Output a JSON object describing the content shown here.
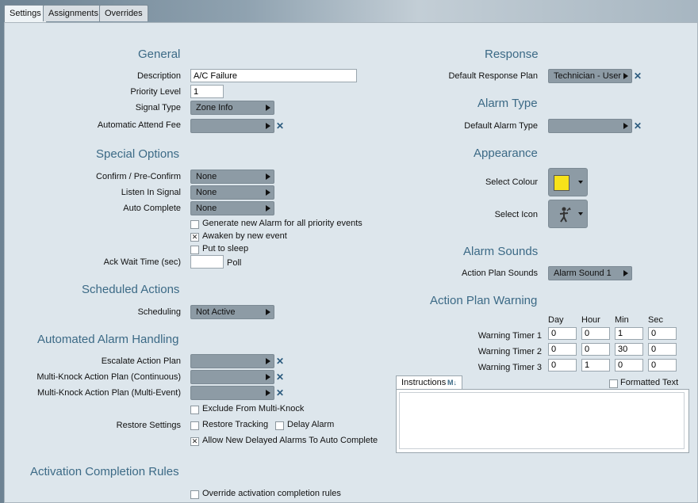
{
  "tabs": {
    "settings": "Settings",
    "assignments": "Assignments",
    "overrides": "Overrides"
  },
  "general": {
    "title": "General",
    "description_label": "Description",
    "description_value": "A/C Failure",
    "priority_label": "Priority Level",
    "priority_value": "1",
    "signal_label": "Signal Type",
    "signal_value": "Zone Info",
    "attend_label": "Automatic Attend Fee",
    "attend_value": ""
  },
  "special": {
    "title": "Special Options",
    "confirm_label": "Confirm / Pre-Confirm",
    "confirm_value": "None",
    "listen_label": "Listen In Signal",
    "listen_value": "None",
    "autocomplete_label": "Auto Complete",
    "autocomplete_value": "None",
    "generate_label": "Generate new Alarm for all priority events",
    "generate_checked": false,
    "awaken_label": "Awaken by new event",
    "awaken_checked": true,
    "sleep_label": "Put to sleep",
    "sleep_checked": false,
    "ackwait_label": "Ack Wait Time (sec)",
    "ackwait_value": "",
    "poll_label": "Poll"
  },
  "scheduled": {
    "title": "Scheduled Actions",
    "scheduling_label": "Scheduling",
    "scheduling_value": "Not Active"
  },
  "automated": {
    "title": "Automated Alarm Handling",
    "escalate_label": "Escalate Action Plan",
    "mk_cont_label": "Multi-Knock Action Plan (Continuous)",
    "mk_multi_label": "Multi-Knock Action Plan (Multi-Event)",
    "exclude_label": "Exclude From Multi-Knock",
    "exclude_checked": false,
    "restore_label": "Restore Settings",
    "restore_tracking_label": "Restore Tracking",
    "restore_tracking_checked": false,
    "delay_label": "Delay Alarm",
    "delay_checked": false,
    "allow_label": "Allow New Delayed Alarms To Auto Complete",
    "allow_checked": true
  },
  "activation": {
    "title": "Activation Completion Rules",
    "override_label": "Override activation completion rules",
    "override_checked": false
  },
  "response": {
    "title": "Response",
    "plan_label": "Default Response Plan",
    "plan_value": "Technician - User"
  },
  "alarmtype": {
    "title": "Alarm Type",
    "label": "Default Alarm Type",
    "value": ""
  },
  "appearance": {
    "title": "Appearance",
    "colour_label": "Select Colour",
    "colour_value": "#f7e21a",
    "icon_label": "Select Icon",
    "icon_name": "wrench-figure-icon"
  },
  "sounds": {
    "title": "Alarm Sounds",
    "label": "Action Plan Sounds",
    "value": "Alarm Sound 1"
  },
  "warning": {
    "title": "Action Plan Warning",
    "headers": [
      "Day",
      "Hour",
      "Min",
      "Sec"
    ],
    "timers": [
      {
        "label": "Warning Timer 1",
        "values": [
          "0",
          "0",
          "1",
          "0"
        ]
      },
      {
        "label": "Warning Timer 2",
        "values": [
          "0",
          "0",
          "30",
          "0"
        ]
      },
      {
        "label": "Warning Timer 3",
        "values": [
          "0",
          "1",
          "0",
          "0"
        ]
      }
    ]
  },
  "instructions": {
    "tab_label": "Instructions",
    "markdown_badge": "M↓",
    "formatted_label": "Formatted Text",
    "formatted_checked": false,
    "text": ""
  }
}
